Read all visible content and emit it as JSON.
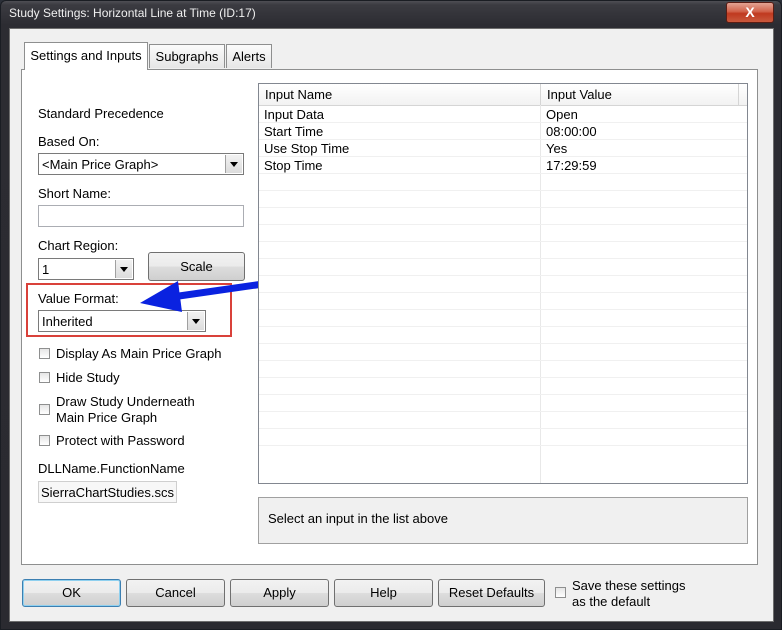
{
  "window": {
    "title": "Study Settings: Horizontal Line at Time (ID:17)",
    "close_glyph": "X"
  },
  "tabs": [
    {
      "label": "Settings and Inputs",
      "active": true
    },
    {
      "label": "Subgraphs",
      "active": false
    },
    {
      "label": "Alerts",
      "active": false
    }
  ],
  "settings": {
    "standard_precedence": "Standard Precedence",
    "based_on_label": "Based On:",
    "based_on_value": "<Main Price Graph>",
    "short_name_label": "Short Name:",
    "short_name_value": "",
    "chart_region_label": "Chart Region:",
    "chart_region_value": "1",
    "scale_button": "Scale",
    "value_format_label": "Value Format:",
    "value_format_value": "Inherited",
    "checkboxes": [
      {
        "label": "Display As Main Price Graph",
        "checked": false
      },
      {
        "label": "Hide Study",
        "checked": false
      },
      {
        "label": "Draw Study Underneath",
        "label2": "Main Price Graph",
        "checked": false
      },
      {
        "label": "Protect with Password",
        "checked": false
      }
    ],
    "dll_label": "DLLName.FunctionName",
    "dll_value": "SierraChartStudies.scs"
  },
  "inputs_table": {
    "columns": [
      "Input Name",
      "Input Value"
    ],
    "rows": [
      {
        "name": "Input Data",
        "value": "Open"
      },
      {
        "name": "Start Time",
        "value": "08:00:00"
      },
      {
        "name": "Use Stop Time",
        "value": "Yes"
      },
      {
        "name": "Stop Time",
        "value": "17:29:59"
      }
    ]
  },
  "description": "Select an input in the list above",
  "buttons": {
    "ok": "OK",
    "cancel": "Cancel",
    "apply": "Apply",
    "help": "Help",
    "reset": "Reset Defaults",
    "save_default_line1": "Save these settings",
    "save_default_line2": "as the default"
  },
  "annotation": {
    "highlight_color": "#d9413a",
    "arrow_color": "#0a22e0"
  },
  "colors": {
    "selected_tab_bg": "#ffffff",
    "dialog_bg": "#f0f0f0"
  }
}
